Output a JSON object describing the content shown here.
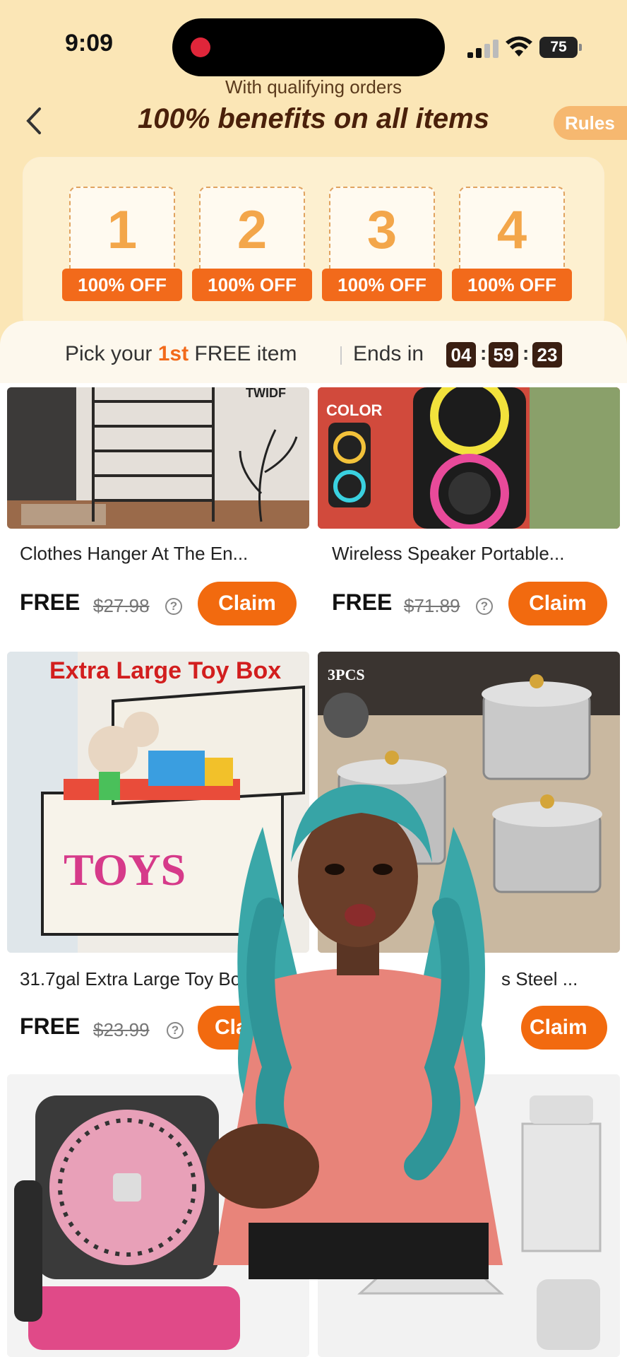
{
  "status": {
    "time": "9:09",
    "battery": "75"
  },
  "header": {
    "subtitle": "With qualifying orders",
    "title": "100% benefits on all items",
    "rules_label": "Rules"
  },
  "benefits": [
    {
      "number": "1",
      "tag": "100% OFF"
    },
    {
      "number": "2",
      "tag": "100% OFF"
    },
    {
      "number": "3",
      "tag": "100% OFF"
    },
    {
      "number": "4",
      "tag": "100% OFF"
    }
  ],
  "pick": {
    "prefix": "Pick your",
    "highlight": "1st",
    "suffix": "FREE item",
    "ends_label": "Ends in",
    "timer": [
      "04",
      "59",
      "23"
    ]
  },
  "products": [
    {
      "title": "Clothes Hanger At The En...",
      "free": "FREE",
      "old_price": "$27.98",
      "claim": "Claim",
      "image_text": "TWIDF"
    },
    {
      "title": "Wireless Speaker Portable...",
      "free": "FREE",
      "old_price": "$71.89",
      "claim": "Claim",
      "image_text": "COLOR"
    },
    {
      "title": "31.7gal Extra Large Toy Bo",
      "free": "FREE",
      "old_price": "$23.99",
      "claim": "Clai",
      "image_text": "Extra Large Toy Box",
      "image_text_2": "TOYS"
    },
    {
      "title": "s Steel ...",
      "claim": "Claim",
      "image_text": "3PCS"
    }
  ]
}
